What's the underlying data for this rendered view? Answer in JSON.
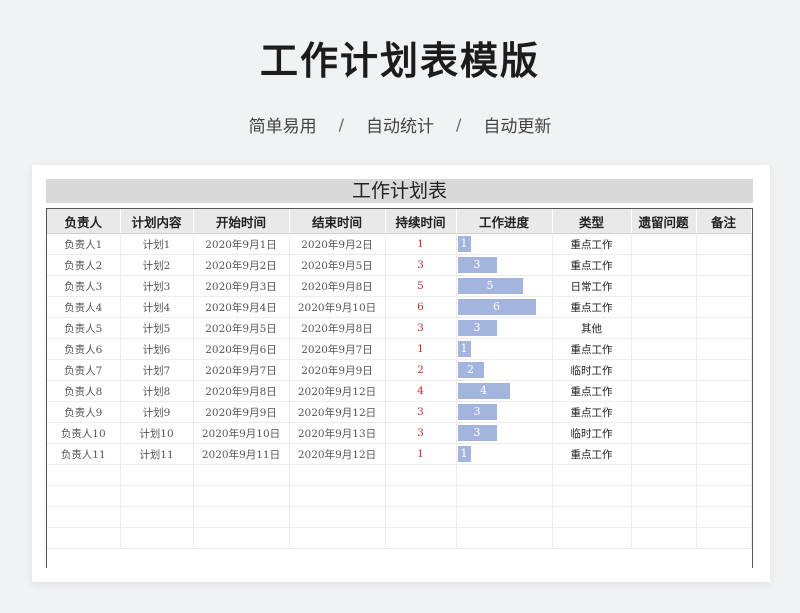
{
  "hero": {
    "title": "工作计划表模版",
    "tags": [
      "简单易用",
      "自动统计",
      "自动更新"
    ],
    "separator": "/"
  },
  "sheet": {
    "title": "工作计划表",
    "headers": [
      "负责人",
      "计划内容",
      "开始时间",
      "结束时间",
      "持续时间",
      "工作进度",
      "类型",
      "遗留问题",
      "备注"
    ],
    "rows": [
      {
        "owner": "负责人1",
        "plan": "计划1",
        "start": "2020年9月1日",
        "end": "2020年9月2日",
        "duration": "1",
        "type": "重点工作"
      },
      {
        "owner": "负责人2",
        "plan": "计划2",
        "start": "2020年9月2日",
        "end": "2020年9月5日",
        "duration": "3",
        "type": "重点工作"
      },
      {
        "owner": "负责人3",
        "plan": "计划3",
        "start": "2020年9月3日",
        "end": "2020年9月8日",
        "duration": "5",
        "type": "日常工作"
      },
      {
        "owner": "负责人4",
        "plan": "计划4",
        "start": "2020年9月4日",
        "end": "2020年9月10日",
        "duration": "6",
        "type": "重点工作"
      },
      {
        "owner": "负责人5",
        "plan": "计划5",
        "start": "2020年9月5日",
        "end": "2020年9月8日",
        "duration": "3",
        "type": "其他"
      },
      {
        "owner": "负责人6",
        "plan": "计划6",
        "start": "2020年9月6日",
        "end": "2020年9月7日",
        "duration": "1",
        "type": "重点工作"
      },
      {
        "owner": "负责人7",
        "plan": "计划7",
        "start": "2020年9月7日",
        "end": "2020年9月9日",
        "duration": "2",
        "type": "临时工作"
      },
      {
        "owner": "负责人8",
        "plan": "计划8",
        "start": "2020年9月8日",
        "end": "2020年9月12日",
        "duration": "4",
        "type": "重点工作"
      },
      {
        "owner": "负责人9",
        "plan": "计划9",
        "start": "2020年9月9日",
        "end": "2020年9月12日",
        "duration": "3",
        "type": "重点工作"
      },
      {
        "owner": "负责人10",
        "plan": "计划10",
        "start": "2020年9月10日",
        "end": "2020年9月13日",
        "duration": "3",
        "type": "临时工作"
      },
      {
        "owner": "负责人11",
        "plan": "计划11",
        "start": "2020年9月11日",
        "end": "2020年9月12日",
        "duration": "1",
        "type": "重点工作"
      }
    ],
    "progress_max": 6
  },
  "colors": {
    "bar": "#a3b4de",
    "duration_text": "#d42a2a",
    "header_bg": "#e9e9e9",
    "title_bg": "#d9d9d9"
  }
}
